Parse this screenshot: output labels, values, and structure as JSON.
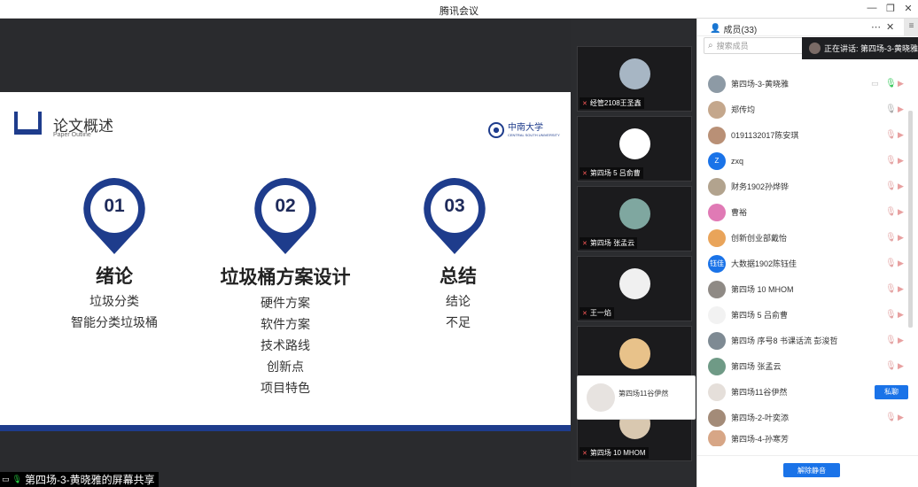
{
  "window": {
    "title": "腾讯会议"
  },
  "slide": {
    "title": "论文概述",
    "subtitle": "Paper Outline",
    "logo_text": "中南大学",
    "logo_sub": "CENTRAL SOUTH UNIVERSITY",
    "sections": [
      {
        "num": "01",
        "heading": "绪论",
        "items": [
          "垃圾分类",
          "智能分类垃圾桶"
        ]
      },
      {
        "num": "02",
        "heading": "垃圾桶方案设计",
        "items": [
          "硬件方案",
          "软件方案",
          "技术路线",
          "创新点",
          "项目特色"
        ]
      },
      {
        "num": "03",
        "heading": "总结",
        "items": [
          "结论",
          "不足"
        ]
      }
    ],
    "share_label": "第四场-3-黄晓雅的屏幕共享"
  },
  "video_tiles": [
    {
      "name": "经管2108王圣鑫"
    },
    {
      "name": "第四场 5 吕俞曹"
    },
    {
      "name": "第四场 张孟云"
    },
    {
      "name": "王一焰"
    },
    {
      "name": ""
    },
    {
      "name": "第四场 10 MHOM"
    }
  ],
  "hover_card": {
    "name": "第四场11谷伊然"
  },
  "panel": {
    "title": "成员(33)",
    "search_placeholder": "搜索成员",
    "speaking_text": "正在讲话: 第四场-3-黄晓雅;",
    "members": [
      {
        "name": "第四场-3-黄晓雅",
        "avatar_text": "",
        "mic": "on"
      },
      {
        "name": "郑传均",
        "avatar_text": "",
        "mic": "idle"
      },
      {
        "name": "0191132017陈安琪",
        "avatar_text": "",
        "mic": "off"
      },
      {
        "name": "zxq",
        "avatar_text": "Z",
        "mic": "off"
      },
      {
        "name": "财务1902孙烨铧",
        "avatar_text": "",
        "mic": "off"
      },
      {
        "name": "曹裕",
        "avatar_text": "",
        "mic": "off"
      },
      {
        "name": "创新创业部戴怡",
        "avatar_text": "",
        "mic": "off"
      },
      {
        "name": "大数据1902陈钰佳",
        "avatar_text": "钰佳",
        "mic": "off"
      },
      {
        "name": "第四场 10 MHOM",
        "avatar_text": "",
        "mic": "off"
      },
      {
        "name": "第四场 5 吕俞曹",
        "avatar_text": "",
        "mic": "off"
      },
      {
        "name": "第四场 序号8 书课话流 彭浚哲",
        "avatar_text": "",
        "mic": "off"
      },
      {
        "name": "第四场 张孟云",
        "avatar_text": "",
        "mic": "off"
      },
      {
        "name": "第四场11谷伊然",
        "avatar_text": "",
        "mic": "button"
      },
      {
        "name": "第四场-2-叶奕添",
        "avatar_text": "",
        "mic": "off"
      },
      {
        "name": "第四场-4-孙寒芳",
        "avatar_text": "",
        "mic": "off"
      }
    ],
    "private_chat_label": "私聊",
    "unmute_all_label": "解除静音"
  },
  "colors": {
    "brand_blue": "#1e3c8c",
    "accent": "#1a73e8",
    "mic_on": "#34c759"
  }
}
